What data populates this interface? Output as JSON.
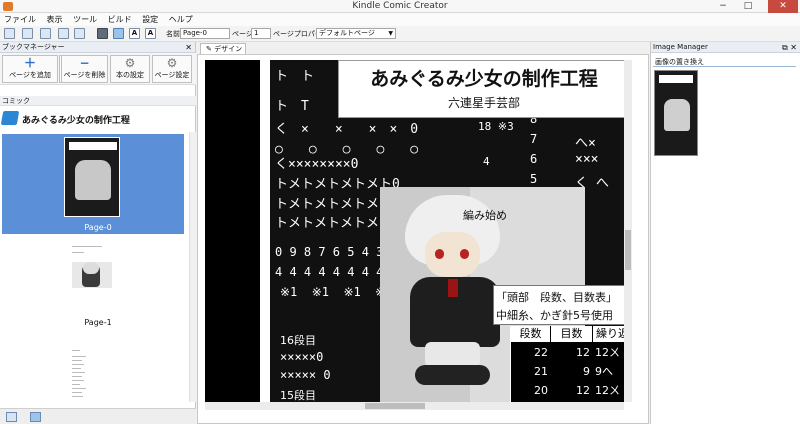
{
  "window": {
    "title": "Kindle Comic Creator",
    "controls": [
      "−",
      "□",
      "✕"
    ]
  },
  "menu": [
    "ファイル",
    "表示",
    "ツール",
    "ビルド",
    "設定",
    "ヘルプ"
  ],
  "toolbar": {
    "name_label": "名前",
    "name_value": "Page-0",
    "page_label": "ページ",
    "page_value": "1",
    "page_prop_label": "ページプロパティ",
    "page_prop_value": "デフォルトページ"
  },
  "bookmark_manager": {
    "title": "ブックマネージャー",
    "buttons": [
      "ページを追加",
      "ページを削除",
      "本の設定",
      "ページ設定"
    ],
    "section": "コミック",
    "book_title": "あみぐるみ少女の制作工程",
    "pages": [
      "Page-0",
      "Page-1"
    ]
  },
  "design_tab": "デザイン",
  "page_art": {
    "heading": "あみぐるみ少女の制作工程",
    "subheading": "六連星手芸部",
    "annotation": "編み始め",
    "info_line1": "「頭部　段数、目数表」",
    "info_line2": "中細糸、かぎ針5号使用",
    "row16": "16段目",
    "row15": "15段目",
    "table_headers": [
      "段数",
      "目数",
      "繰り返"
    ],
    "table_rows": [
      [
        "22",
        "12",
        "12ㄨ"
      ],
      [
        "21",
        "9",
        "9へ"
      ],
      [
        "20",
        "12",
        "12ㄨ"
      ]
    ],
    "row_numbers": [
      "8",
      "7",
      "6",
      "5",
      "4",
      "3",
      "2",
      "1"
    ],
    "number_row1": "0 9 8 7 6 5 4 3 2 1",
    "number_row2": "4 4 4 4 4 4 4 4 4 4",
    "x1_row": "※1  ※1  ※1  ※1",
    "mark_18": "18 ※3",
    "mark_4": "4"
  },
  "image_manager": {
    "title": "Image Manager",
    "replace_label": "画像の置き換え"
  }
}
